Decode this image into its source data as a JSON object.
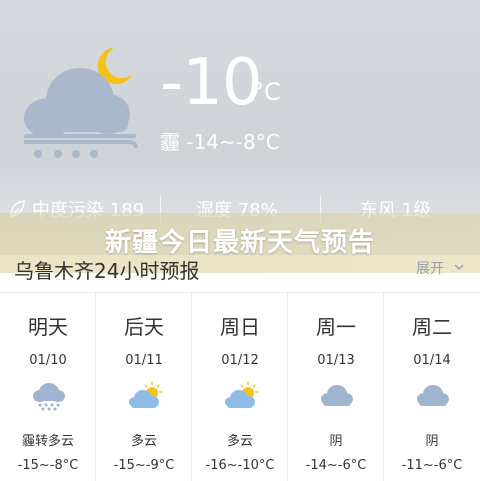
{
  "current": {
    "temperature": "-10",
    "unit": "°C",
    "condition": "霾 -14~-8°C",
    "icon": "snow-night-cloud-icon"
  },
  "metrics": [
    {
      "label": "中度污染 189",
      "icon": "leaf-icon"
    },
    {
      "label": "湿度 78%"
    },
    {
      "label": "东风 1级"
    }
  ],
  "headline": "新疆今日最新天气预告",
  "forecast": {
    "title": "乌鲁木齐24小时预报",
    "expand_label": "展开"
  },
  "days": [
    {
      "name": "明天",
      "date": "01/10",
      "icon": "snow-cloud-icon",
      "condition": "霾转多云",
      "range": "-15~-8°C"
    },
    {
      "name": "后天",
      "date": "01/11",
      "icon": "partly-cloudy-icon",
      "condition": "多云",
      "range": "-15~-9°C"
    },
    {
      "name": "周日",
      "date": "01/12",
      "icon": "partly-cloudy-icon",
      "condition": "多云",
      "range": "-16~-10°C"
    },
    {
      "name": "周一",
      "date": "01/13",
      "icon": "cloudy-icon",
      "condition": "阴",
      "range": "-14~-6°C"
    },
    {
      "name": "周二",
      "date": "01/14",
      "icon": "cloudy-icon",
      "condition": "阴",
      "range": "-11~-6°C"
    }
  ],
  "colors": {
    "sun": "#f5c21b",
    "cloud": "#9fb4cf",
    "headline_band": "#dccf9a"
  }
}
